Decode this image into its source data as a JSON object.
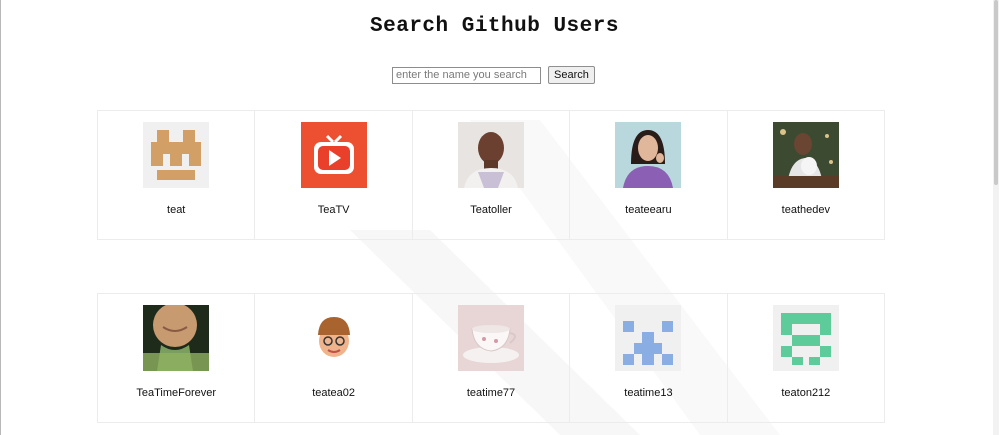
{
  "page": {
    "title": "Search Github Users"
  },
  "search": {
    "placeholder": "enter the name you search",
    "value": "",
    "button_label": "Search"
  },
  "users": [
    {
      "login": "teat",
      "avatar": "teat-identicon"
    },
    {
      "login": "TeaTV",
      "avatar": "teatv-logo"
    },
    {
      "login": "Teatoller",
      "avatar": "teatoller-photo"
    },
    {
      "login": "teateearu",
      "avatar": "teateearu-photo"
    },
    {
      "login": "teathedev",
      "avatar": "teathedev-photo"
    },
    {
      "login": "TeaTimeForever",
      "avatar": "teatimeforever-photo"
    },
    {
      "login": "teatea02",
      "avatar": "teatea02-memoji"
    },
    {
      "login": "teatime77",
      "avatar": "teatime77-teacup-photo"
    },
    {
      "login": "teatime13",
      "avatar": "teatime13-identicon"
    },
    {
      "login": "teaton212",
      "avatar": "teaton212-identicon"
    }
  ],
  "colors": {
    "teat_identicon": "#d2a066",
    "teatime13_identicon": "#8aaee3",
    "teaton212_identicon": "#5ecb9a",
    "teatv_red": "#e8402a"
  }
}
